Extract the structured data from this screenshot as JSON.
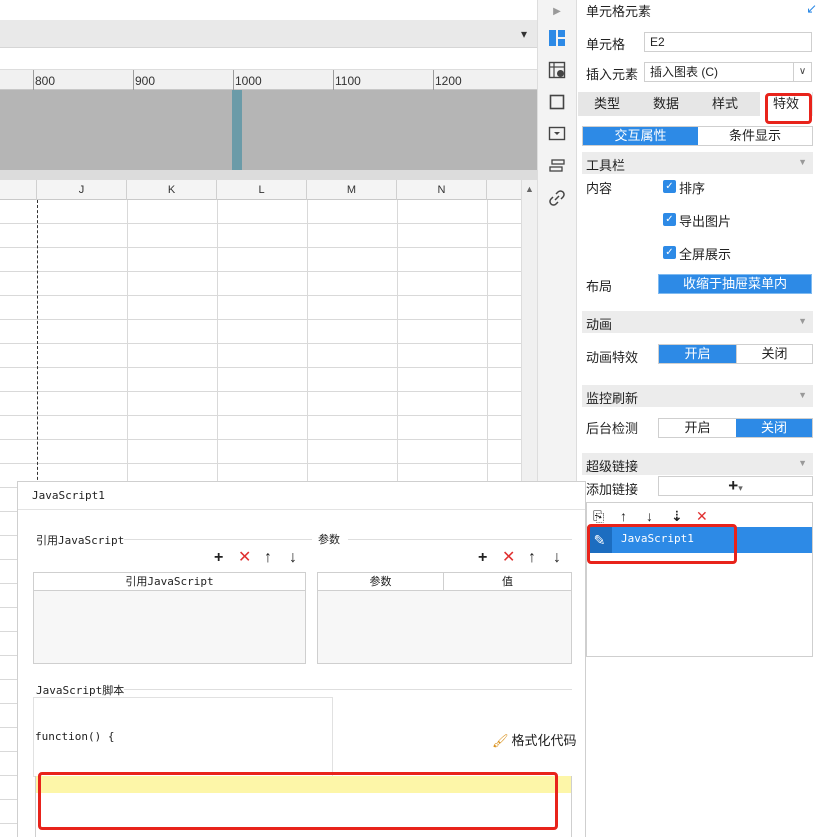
{
  "toolbar": {
    "dropdown_icon": "format-dropdown-icon",
    "dropdown_glyph": "▾"
  },
  "ruler": {
    "ticks": [
      "800",
      "900",
      "1000",
      "1100",
      "1200"
    ]
  },
  "grid": {
    "columns": [
      "J",
      "K",
      "L",
      "M",
      "N"
    ]
  },
  "panel": {
    "title": "单元格元素",
    "cell_label": "单元格",
    "cell_value": "E2",
    "insert_label": "插入元素",
    "insert_value": "插入图表 (C)",
    "tabs": [
      "类型",
      "数据",
      "样式",
      "特效"
    ],
    "active_tab": "特效",
    "subtabs": [
      "交互属性",
      "条件显示"
    ],
    "active_subtab": "交互属性",
    "toolbar_section": "工具栏",
    "content_label": "内容",
    "checkboxes": [
      "排序",
      "导出图片",
      "全屏展示"
    ],
    "layout_label": "布局",
    "layout_value": "收缩于抽屉菜单内",
    "animation_section": "动画",
    "animation_label": "动画特效",
    "animation_options": [
      "开启",
      "关闭"
    ],
    "animation_selected": "开启",
    "monitor_section": "监控刷新",
    "monitor_label": "后台检测",
    "monitor_options": [
      "开启",
      "关闭"
    ],
    "monitor_selected": "关闭",
    "hyperlink_section": "超级链接",
    "add_link_label": "添加链接",
    "add_link_glyph": "+",
    "link_items": [
      "JavaScript1"
    ]
  },
  "dialog": {
    "title": "JavaScript1",
    "ref_js_group": "引用JavaScript",
    "ref_js_column": "引用JavaScript",
    "params_group": "参数",
    "params_columns": [
      "参数",
      "值"
    ],
    "script_group": "JavaScript脚本",
    "function_text": "function() {",
    "format_label": "格式化代码"
  },
  "colors": {
    "accent": "#2d8ae6",
    "highlight": "#e8231b",
    "delete": "#e03030",
    "editor_line": "#fdf6a8"
  }
}
